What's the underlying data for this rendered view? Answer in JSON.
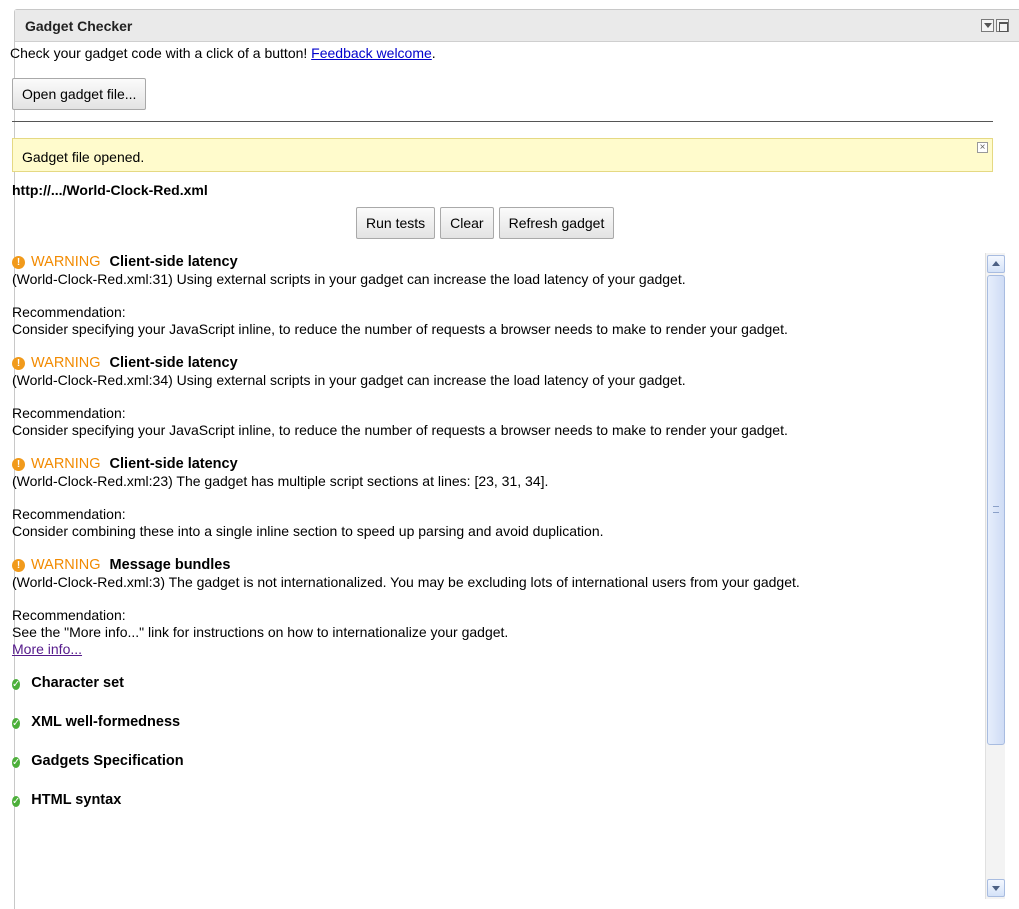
{
  "panel": {
    "title": "Gadget Checker",
    "intro_text": "Check your gadget code with a click of a button!",
    "feedback_link": "Feedback welcome",
    "intro_suffix": ".",
    "open_button": "Open gadget file..."
  },
  "notice": {
    "message": "Gadget file opened.",
    "close": "×"
  },
  "file": {
    "path": "http://.../World-Clock-Red.xml"
  },
  "actions": {
    "run_tests": "Run tests",
    "clear": "Clear",
    "refresh": "Refresh gadget"
  },
  "results": {
    "warnings": [
      {
        "severity": "WARNING",
        "category": "Client-side latency",
        "message": "(World-Clock-Red.xml:31) Using external scripts in your gadget can increase the load latency of your gadget.",
        "rec_label": "Recommendation:",
        "recommendation": "Consider specifying your JavaScript inline, to reduce the number of requests a browser needs to make to render your gadget."
      },
      {
        "severity": "WARNING",
        "category": "Client-side latency",
        "message": "(World-Clock-Red.xml:34) Using external scripts in your gadget can increase the load latency of your gadget.",
        "rec_label": "Recommendation:",
        "recommendation": "Consider specifying your JavaScript inline, to reduce the number of requests a browser needs to make to render your gadget."
      },
      {
        "severity": "WARNING",
        "category": "Client-side latency",
        "message": "(World-Clock-Red.xml:23) The gadget has multiple script sections at lines: [23, 31, 34].",
        "rec_label": "Recommendation:",
        "recommendation": "Consider combining these into a single inline section to speed up parsing and avoid duplication."
      },
      {
        "severity": "WARNING",
        "category": "Message bundles",
        "message": "(World-Clock-Red.xml:3) The gadget is not internationalized. You may be excluding lots of international users from your gadget.",
        "rec_label": "Recommendation:",
        "recommendation": "See the \"More info...\" link for instructions on how to internationalize your gadget.",
        "more_info": "More info..."
      }
    ],
    "passed": [
      "Character set",
      "XML well-formedness",
      "Gadgets Specification",
      "HTML syntax"
    ]
  },
  "colors": {
    "warning": "#f28a00",
    "pass": "#4caf3a",
    "notice_bg": "#fffbcc",
    "link": "#0000cc"
  }
}
